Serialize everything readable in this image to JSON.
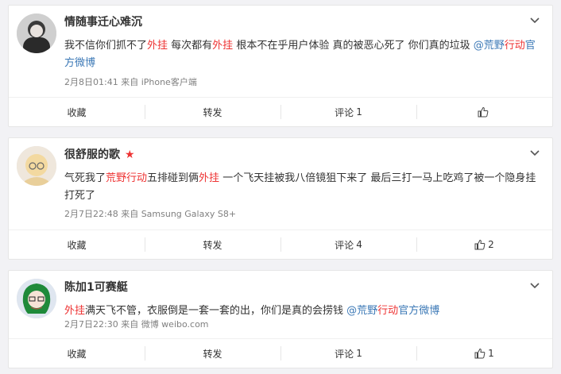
{
  "posts": [
    {
      "username": "情随事迁心难沉",
      "badge_star": false,
      "content_parts": [
        {
          "t": "我不信你们抓不了",
          "c": "n"
        },
        {
          "t": "外挂",
          "c": "h"
        },
        {
          "t": " 每次都有",
          "c": "n"
        },
        {
          "t": "外挂",
          "c": "h"
        },
        {
          "t": " 根本不在乎用户体验 真的被恶心死了 你们真的垃圾 ",
          "c": "n"
        },
        {
          "t": "@荒野",
          "c": "l"
        },
        {
          "t": "行动",
          "c": "h"
        },
        {
          "t": "官方微博",
          "c": "l"
        }
      ],
      "meta": "2月8日01:41 来自 iPhone客户端",
      "actions": {
        "favorite": "收藏",
        "repost": "转发",
        "comment": "评论",
        "comment_count": "1",
        "like_count": ""
      }
    },
    {
      "username": "很舒服的歌",
      "badge_star": true,
      "content_parts": [
        {
          "t": "气死我了",
          "c": "n"
        },
        {
          "t": "荒野行动",
          "c": "h"
        },
        {
          "t": "五排碰到俩",
          "c": "n"
        },
        {
          "t": "外挂",
          "c": "h"
        },
        {
          "t": " 一个飞天挂被我八倍镜狙下来了 最后三打一马上吃鸡了被一个隐身挂打死了",
          "c": "n"
        }
      ],
      "meta": "2月7日22:48 来自 Samsung Galaxy S8+",
      "actions": {
        "favorite": "收藏",
        "repost": "转发",
        "comment": "评论",
        "comment_count": "4",
        "like_count": "2"
      }
    },
    {
      "username": "陈加1可赛艇",
      "badge_star": false,
      "content_parts": [
        {
          "t": "外挂",
          "c": "h"
        },
        {
          "t": "满天飞不管，衣服倒是一套一套的出，你们是真的会捞钱 ",
          "c": "n"
        },
        {
          "t": "@荒野",
          "c": "l"
        },
        {
          "t": "行动",
          "c": "h"
        },
        {
          "t": "官方微博",
          "c": "l"
        }
      ],
      "meta": "2月7日22:30 来自 微博 weibo.com",
      "actions": {
        "favorite": "收藏",
        "repost": "转发",
        "comment": "评论",
        "comment_count": "1",
        "like_count": "1"
      }
    }
  ]
}
